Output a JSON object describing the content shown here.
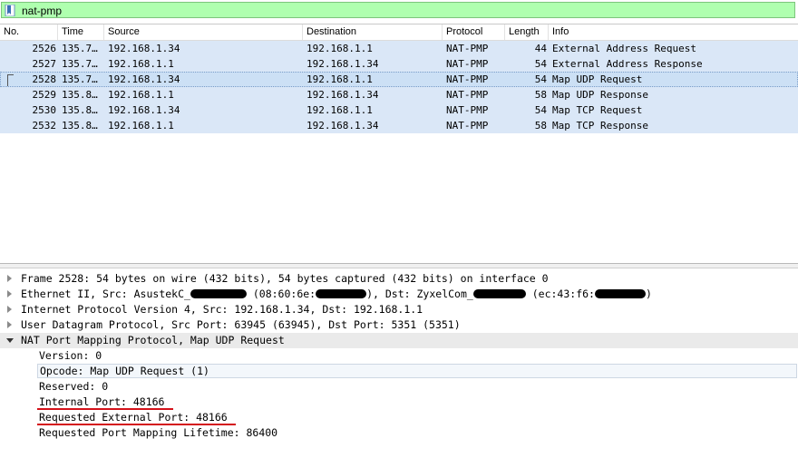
{
  "filter": {
    "value": "nat-pmp",
    "bookmark_icon": "bookmark-icon",
    "background_color": "#afffaf"
  },
  "packet_list": {
    "columns": [
      "No.",
      "Time",
      "Source",
      "Destination",
      "Protocol",
      "Length",
      "Info"
    ],
    "rows": [
      {
        "no": "2526",
        "time": "135.7…",
        "source": "192.168.1.34",
        "destination": "192.168.1.1",
        "protocol": "NAT-PMP",
        "length": "44",
        "info": "External Address Request"
      },
      {
        "no": "2527",
        "time": "135.7…",
        "source": "192.168.1.1",
        "destination": "192.168.1.34",
        "protocol": "NAT-PMP",
        "length": "54",
        "info": "External Address Response"
      },
      {
        "no": "2528",
        "time": "135.7…",
        "source": "192.168.1.34",
        "destination": "192.168.1.1",
        "protocol": "NAT-PMP",
        "length": "54",
        "info": "Map UDP Request"
      },
      {
        "no": "2529",
        "time": "135.8…",
        "source": "192.168.1.1",
        "destination": "192.168.1.34",
        "protocol": "NAT-PMP",
        "length": "58",
        "info": "Map UDP Response"
      },
      {
        "no": "2530",
        "time": "135.8…",
        "source": "192.168.1.34",
        "destination": "192.168.1.1",
        "protocol": "NAT-PMP",
        "length": "54",
        "info": "Map TCP Request"
      },
      {
        "no": "2532",
        "time": "135.8…",
        "source": "192.168.1.1",
        "destination": "192.168.1.34",
        "protocol": "NAT-PMP",
        "length": "58",
        "info": "Map TCP Response"
      }
    ],
    "selected_row": "2528",
    "row_color": "#dae7f7"
  },
  "details": {
    "frame": "Frame 2528: 54 bytes on wire (432 bits), 54 bytes captured (432 bits) on interface 0",
    "ethernet": {
      "prefix": "Ethernet II, Src: AsustekC_",
      "mid1": " (08:60:6e:",
      "mid2": "), Dst: ZyxelCom_",
      "mid3": " (ec:43:f6:",
      "suffix": ")"
    },
    "ip": "Internet Protocol Version 4, Src: 192.168.1.34, Dst: 192.168.1.1",
    "udp": "User Datagram Protocol, Src Port: 63945 (63945), Dst Port: 5351 (5351)",
    "natpmp": "NAT Port Mapping Protocol, Map UDP Request",
    "fields": [
      "Version: 0",
      "Opcode: Map UDP Request (1)",
      "Reserved: 0",
      "Internal Port: 48166",
      "Requested External Port: 48166",
      "Requested Port Mapping Lifetime: 86400"
    ],
    "underline_color": "#d4121a"
  }
}
